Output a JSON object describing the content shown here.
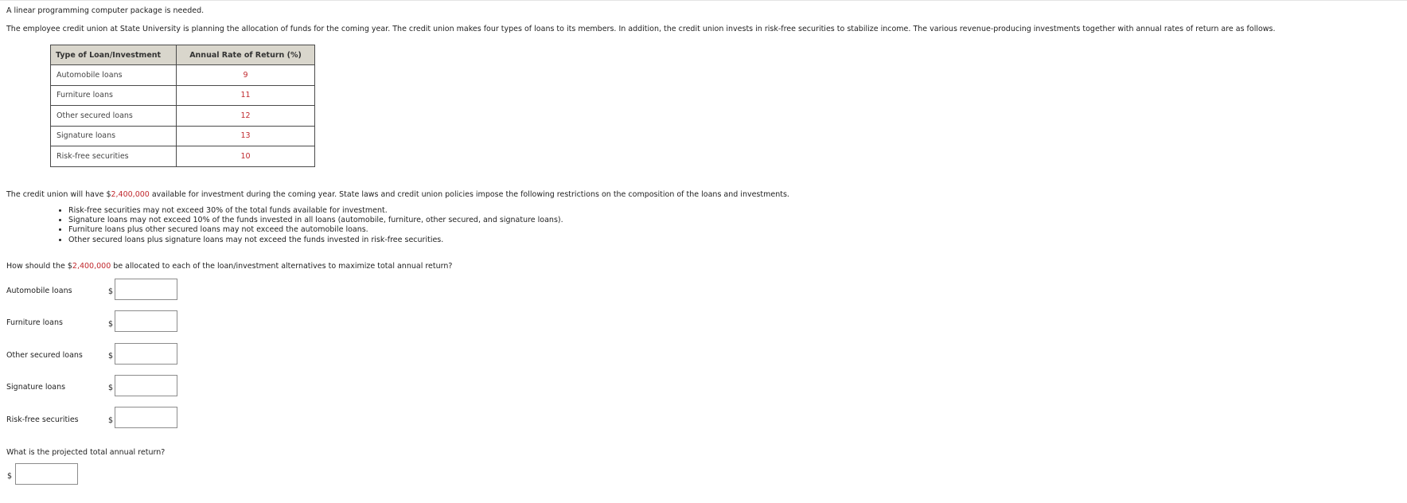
{
  "intro": "A linear programming computer package is needed.",
  "description": "The employee credit union at State University is planning the allocation of funds for the coming year. The credit union makes four types of loans to its members. In addition, the credit union invests in risk-free securities to stabilize income. The various revenue-producing investments together with annual rates of return are as follows.",
  "table": {
    "headers": [
      "Type of Loan/Investment",
      "Annual Rate of Return (%)"
    ],
    "rows": [
      {
        "type": "Automobile loans",
        "rate": "9"
      },
      {
        "type": "Furniture loans",
        "rate": "11"
      },
      {
        "type": "Other secured loans",
        "rate": "12"
      },
      {
        "type": "Signature loans",
        "rate": "13"
      },
      {
        "type": "Risk-free securities",
        "rate": "10"
      }
    ]
  },
  "funds": {
    "prefix": "The credit union will have $",
    "amount": "2,400,000",
    "suffix": " available for investment during the coming year. State laws and credit union policies impose the following restrictions on the composition of the loans and investments."
  },
  "restrictions": [
    "Risk-free securities may not exceed 30% of the total funds available for investment.",
    "Signature loans may not exceed 10% of the funds invested in all loans (automobile, furniture, other secured, and signature loans).",
    "Furniture loans plus other secured loans may not exceed the automobile loans.",
    "Other secured loans plus signature loans may not exceed the funds invested in risk-free securities."
  ],
  "question": {
    "prefix": "How should the $",
    "amount": "2,400,000",
    "suffix": " be allocated to each of the loan/investment alternatives to maximize total annual return?"
  },
  "currency_symbol": "$",
  "answers": [
    {
      "label": "Automobile loans",
      "value": ""
    },
    {
      "label": "Furniture loans",
      "value": ""
    },
    {
      "label": "Other secured loans",
      "value": ""
    },
    {
      "label": "Signature loans",
      "value": ""
    },
    {
      "label": "Risk-free securities",
      "value": ""
    }
  ],
  "total_question": "What is the projected total annual return?",
  "total_value": "",
  "colors": {
    "highlight_red": "#c0282d",
    "table_header_bg": "#d9d6cc"
  }
}
